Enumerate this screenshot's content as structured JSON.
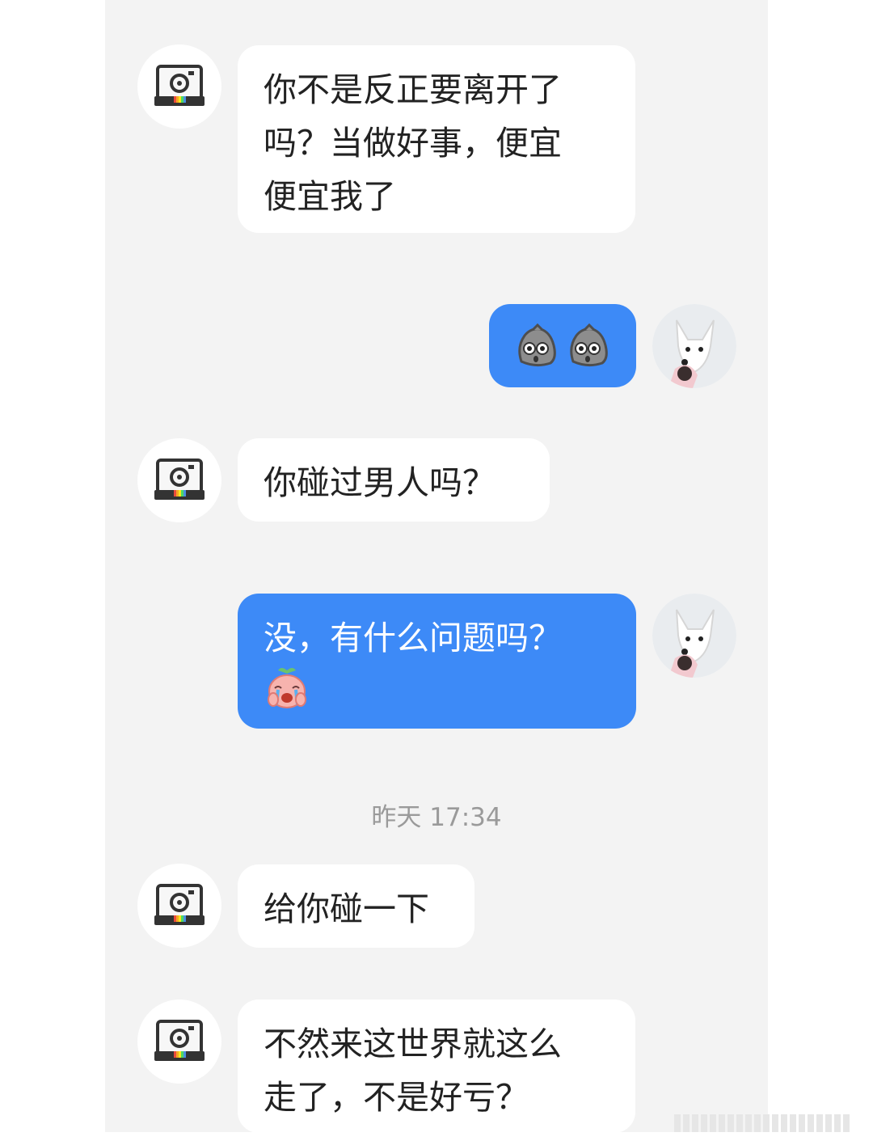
{
  "conversation": {
    "messages": [
      {
        "sender": "them",
        "text": "你不是反正要离开了\n吗？当做好事，便宜\n便宜我了"
      },
      {
        "sender": "me",
        "emojis": [
          "shocked-rock-emoji",
          "shocked-rock-emoji"
        ]
      },
      {
        "sender": "them",
        "text": "你碰过男人吗？"
      },
      {
        "sender": "me",
        "text": "没，有什么问题吗？",
        "emojis": [
          "crying-peach-emoji"
        ]
      },
      {
        "sender": "them",
        "text": "给你碰一下"
      },
      {
        "sender": "them",
        "text": "不然来这世界就这么\n走了，不是好亏？"
      }
    ],
    "timestamp": "昨天 17:34"
  },
  "colors": {
    "chat_background": "#f3f3f3",
    "my_bubble": "#3d8af7",
    "their_bubble": "#ffffff",
    "timestamp_text": "#9a9a9a"
  },
  "avatars": {
    "them": "camera-icon",
    "me": "white-dog-avatar"
  }
}
